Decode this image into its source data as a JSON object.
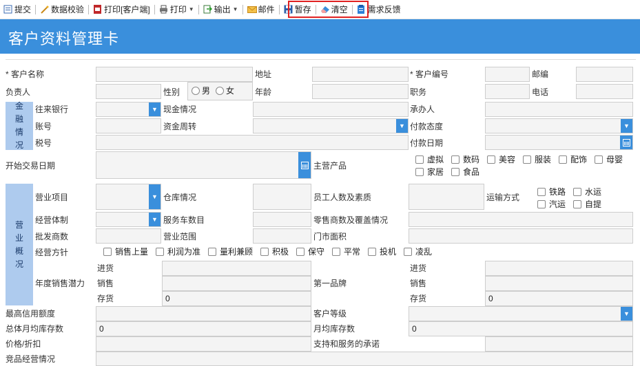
{
  "toolbar": {
    "submit": "提交",
    "validate": "数据校验",
    "print_client": "打印[客户端]",
    "print": "打印",
    "export": "输出",
    "mail": "邮件",
    "save_draft": "暂存",
    "clear": "清空",
    "feedback": "需求反馈"
  },
  "colors": {
    "accent": "#3a8fdc",
    "side_panel": "#aecbee",
    "highlight": "#e02020"
  },
  "page": {
    "title": "客户资料管理卡"
  },
  "labels": {
    "customer_name": "* 客户名称",
    "address": "地址",
    "customer_no": "* 客户编号",
    "postcode": "邮编",
    "owner": "负责人",
    "gender": "性别",
    "age": "年龄",
    "job": "职务",
    "phone": "电话",
    "bank": "往来银行",
    "cash": "现金情况",
    "handler": "承办人",
    "account": "账号",
    "turnover": "资金周转",
    "pay_attitude": "付款态度",
    "tax_no": "税号",
    "pay_date": "付款日期",
    "start_date": "开始交易日期",
    "main_products": "主营产品",
    "biz_project": "营业项目",
    "warehouse": "仓库情况",
    "staff": "员工人数及素质",
    "transport": "运输方式",
    "biz_system": "经营体制",
    "service_cars": "服务车数目",
    "retailers": "零售商数及覆盖情况",
    "wholesalers": "批发商数",
    "biz_scope": "营业范围",
    "store_area": "门市面积",
    "biz_policy": "经营方针",
    "annual_potential": "年度销售潜力",
    "purchase": "进货",
    "sales": "销售",
    "stock": "存货",
    "top_brand": "第一品牌",
    "credit_limit": "最高信用额度",
    "customer_level": "客户等级",
    "total_monthly_stock": "总体月均库存数",
    "monthly_stock": "月均库存数",
    "price_discount": "价格/折扣",
    "support_promise": "支持和服务的承诺",
    "competitor": "竞品经营情况"
  },
  "side": {
    "finance": [
      "金",
      "融",
      "情",
      "况"
    ],
    "business": [
      "营",
      "业",
      "概",
      "况"
    ]
  },
  "gender_options": [
    "男",
    "女"
  ],
  "product_options": [
    "虚拟",
    "数码",
    "美容",
    "服装",
    "配饰",
    "母婴",
    "家居",
    "食品"
  ],
  "transport_options": [
    "铁路",
    "水运",
    "汽运",
    "自提"
  ],
  "policy_options": [
    "销售上量",
    "利润为准",
    "量利兼顾",
    "积极",
    "保守",
    "平常",
    "投机",
    "凌乱"
  ],
  "values": {
    "stock_left": "0",
    "stock_right": "0",
    "total_monthly_stock": "0",
    "monthly_stock": "0"
  }
}
